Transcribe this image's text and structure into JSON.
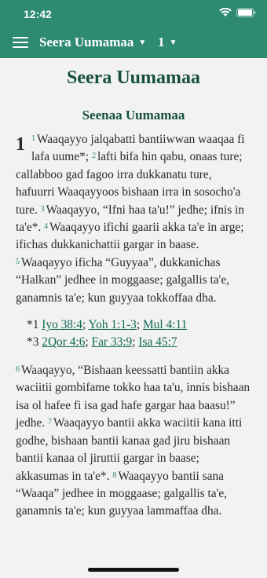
{
  "status": {
    "time": "12:42"
  },
  "header": {
    "book": "Seera Uumamaa",
    "chapter": "1"
  },
  "content": {
    "title": "Seera Uumamaa",
    "section": "Seenaa Uumamaa",
    "chapter_num": "1",
    "p1": [
      {
        "n": "1",
        "t": "Waaqayyo jalqabatti bantiiwwan waaqaa fi lafa uume*; "
      },
      {
        "n": "2",
        "t": "lafti bifa hin qabu, onaas ture; callabboo gad fagoo irra dukkanatu ture, hafuurri Waaqayyoos bishaan irra in sosocho'a ture. "
      },
      {
        "n": "3",
        "t": "Waaqayyo, “Ifni haa ta'u!” jedhe; ifnis in ta'e*. "
      },
      {
        "n": "4",
        "t": "Waaqayyo ifichi gaarii akka ta'e in arge; ifichas dukkanichattii gargar in baase. "
      },
      {
        "n": "5",
        "t": "Waaqayyo ificha “Guyyaa”, dukkanichas “Halkan” jedhee in moggaase; galgallis ta'e, ganamnis ta'e; kun guyyaa tokkoffaa dha."
      }
    ],
    "notes": [
      {
        "label": "*1",
        "refs": [
          "Iyo 38:4",
          "Yoh 1:1-3",
          "Mul 4:11"
        ]
      },
      {
        "label": "*3",
        "refs": [
          "2Qor 4:6",
          "Far 33:9",
          "Isa 45:7"
        ]
      }
    ],
    "p2": [
      {
        "n": "6",
        "t": "Waaqayyo, “Bishaan keessatti bantiin akka waciitii gombifame tokko haa ta'u, innis bishaan isa ol hafee fi isa gad hafe gargar haa baasu!” jedhe. "
      },
      {
        "n": "7",
        "t": "Waaqayyo bantii akka waciitii kana itti godhe, bishaan bantii kanaa gad jiru bishaan bantii kanaa ol jiruttii gargar in baase; akkasumas in ta'e*. "
      },
      {
        "n": "8",
        "t": "Waaqayyo bantii sana “Waaqa” jedhee in moggaase; galgallis ta'e, ganamnis ta'e; kun guyyaa lammaffaa dha."
      }
    ]
  }
}
